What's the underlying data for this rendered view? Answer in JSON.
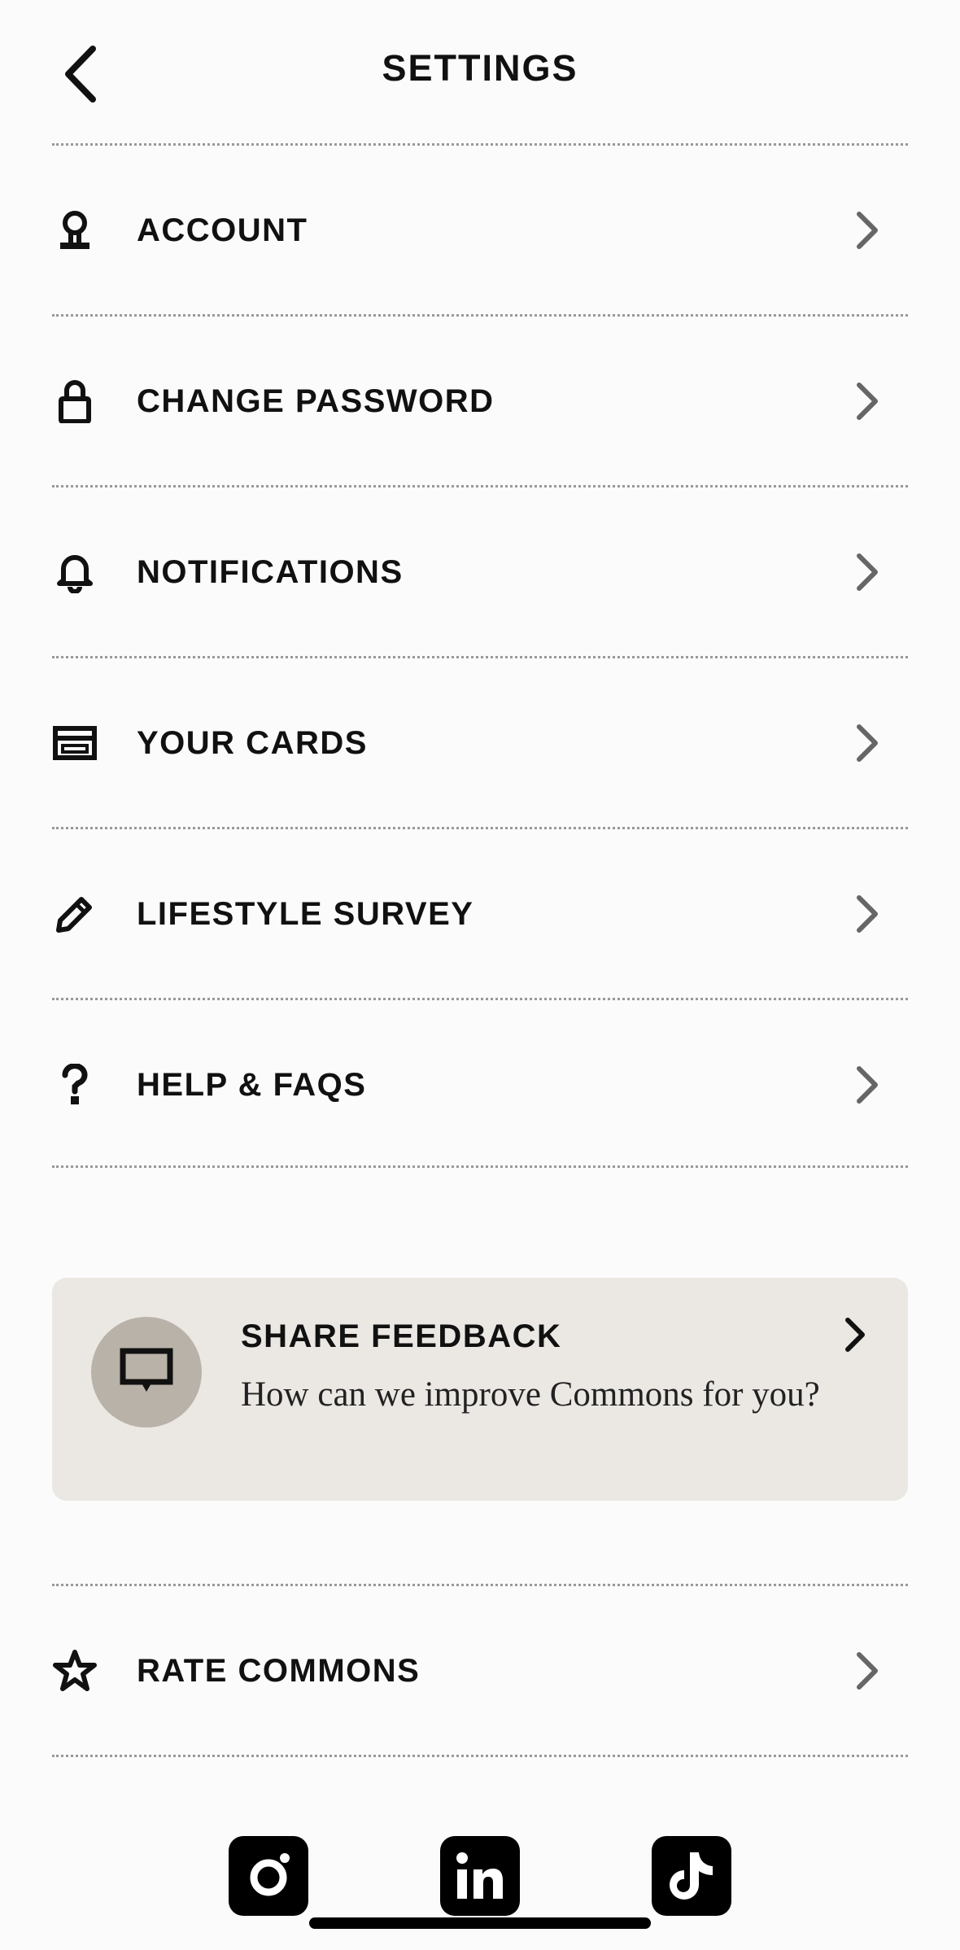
{
  "header": {
    "title": "SETTINGS"
  },
  "menu": [
    {
      "label": "ACCOUNT",
      "icon": "user-icon"
    },
    {
      "label": "CHANGE PASSWORD",
      "icon": "lock-icon"
    },
    {
      "label": "NOTIFICATIONS",
      "icon": "bell-icon"
    },
    {
      "label": "YOUR CARDS",
      "icon": "card-icon"
    },
    {
      "label": "LIFESTYLE SURVEY",
      "icon": "pencil-icon"
    },
    {
      "label": "HELP & FAQS",
      "icon": "question-icon"
    }
  ],
  "feedback": {
    "title": "SHARE FEEDBACK",
    "subtitle": "How can we improve Commons for you?",
    "icon": "chat-bubble-icon"
  },
  "rate": {
    "label": "RATE COMMONS",
    "icon": "star-icon"
  },
  "social": [
    "instagram-icon",
    "linkedin-icon",
    "tiktok-icon"
  ],
  "colors": {
    "background": "#fcfbfc",
    "feedback_card": "#ebe8e4",
    "feedback_circle": "#b9b2a8",
    "chevron": "#666666"
  }
}
